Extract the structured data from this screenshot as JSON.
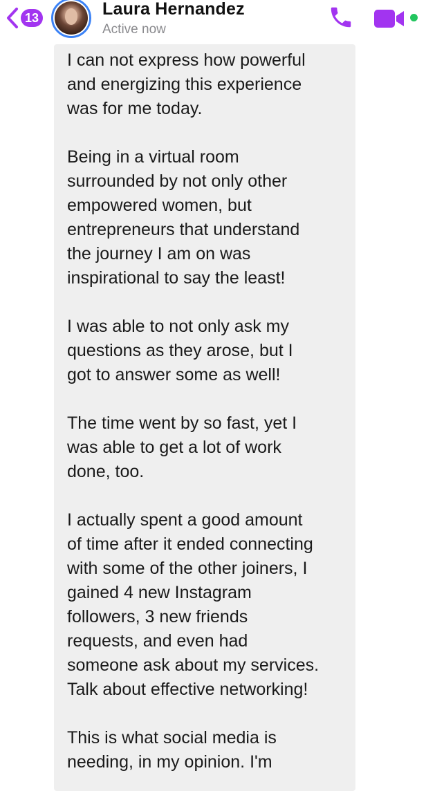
{
  "header": {
    "unread_count": "13",
    "contact_name": "Laura Hernandez",
    "status": "Active now"
  },
  "icons": {
    "back": "chevron-left-icon",
    "call": "phone-icon",
    "video": "video-camera-icon",
    "online": "online-dot"
  },
  "colors": {
    "accent": "#a234f0",
    "online": "#22c55e",
    "avatar_ring": "#3b82f6",
    "bubble": "#efefef"
  },
  "message": {
    "text": "I can not express how powerful\nand energizing this experience\nwas for me today.\n\nBeing in a virtual room\nsurrounded by not only other\nempowered women, but\nentrepreneurs that understand\nthe journey I am on was\ninspirational to say the least!\n\nI was able to not only ask my\nquestions as they arose, but I\ngot to answer some as well!\n\nThe time went by so fast, yet I\nwas able to get a lot of work\ndone, too.\n\nI actually spent a good amount\nof time after it ended connecting\nwith some of the other joiners, I\ngained 4 new Instagram\nfollowers, 3 new friends\nrequests, and even had\nsomeone ask about my services.\nTalk about effective networking!\n\nThis is what social media is\nneeding, in my opinion. I'm"
  }
}
